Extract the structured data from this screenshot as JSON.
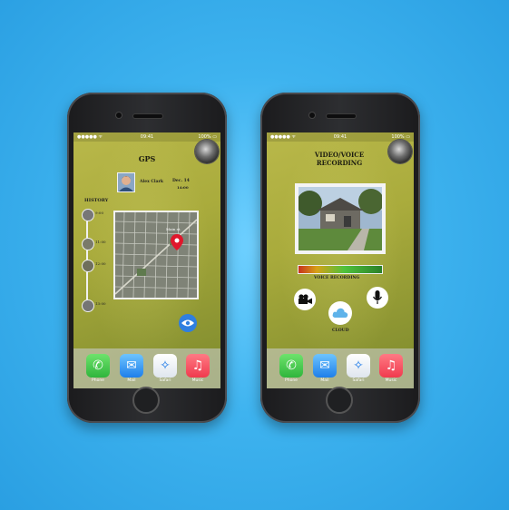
{
  "status": {
    "signal": "●●●●● ᯤ",
    "time": "09:41",
    "battery": "100% ▭"
  },
  "left": {
    "title": "GPS",
    "user_name": "Alex Clark",
    "date": "Dec. 14",
    "time": "14:00",
    "history_label": "HISTORY",
    "map_label": "Main st.",
    "history_items": [
      "9:00",
      "11:00",
      "12:00",
      "13:00"
    ]
  },
  "right": {
    "title_line1": "VIDEO/VOICE",
    "title_line2": "RECORDING",
    "voice_label": "VOICE RECORDING",
    "cloud_label": "CLOUD"
  },
  "dock": {
    "phone": "Phone",
    "mail": "Mail",
    "safari": "Safari",
    "music": "Music"
  },
  "colors": {
    "screen_green": "#a9ab3c",
    "background": "#3eb3ef",
    "pin_red": "#e0182c"
  }
}
